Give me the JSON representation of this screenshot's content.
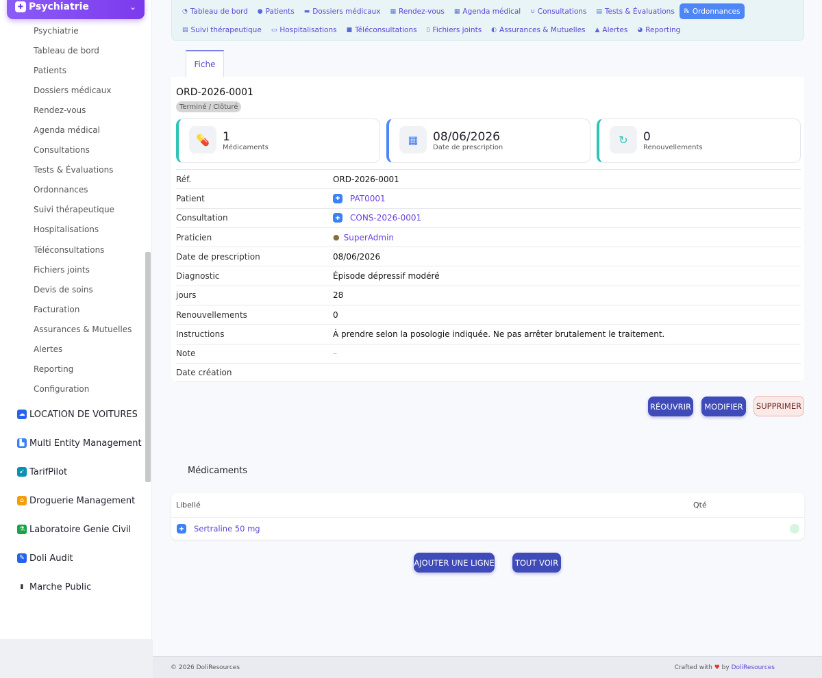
{
  "sidebar": {
    "module_label": "Psychiatrie",
    "items": [
      {
        "label": "Psychiatrie"
      },
      {
        "label": "Tableau de bord"
      },
      {
        "label": "Patients"
      },
      {
        "label": "Dossiers médicaux"
      },
      {
        "label": "Rendez-vous"
      },
      {
        "label": "Agenda médical"
      },
      {
        "label": "Consultations"
      },
      {
        "label": "Tests & Évaluations"
      },
      {
        "label": "Ordonnances"
      },
      {
        "label": "Suivi thérapeutique"
      },
      {
        "label": "Hospitalisations"
      },
      {
        "label": "Téléconsultations"
      },
      {
        "label": "Fichiers joints"
      },
      {
        "label": "Devis de soins"
      },
      {
        "label": "Facturation"
      },
      {
        "label": "Assurances & Mutuelles"
      },
      {
        "label": "Alertes"
      },
      {
        "label": "Reporting"
      },
      {
        "label": "Configuration"
      }
    ],
    "apps": [
      {
        "label": "LOCATION DE VOITURES",
        "icon": "car-icon",
        "color": "#2563eb"
      },
      {
        "label": "Multi Entity Management",
        "icon": "building-icon",
        "color": "#3b82f6"
      },
      {
        "label": "TarifPilot",
        "icon": "tag-icon",
        "color": "#0891b2"
      },
      {
        "label": "Droguerie Management",
        "icon": "store-icon",
        "color": "#f59e0b"
      },
      {
        "label": "Laboratoire Genie Civil",
        "icon": "flask-icon",
        "color": "#16a34a"
      },
      {
        "label": "Doli Audit",
        "icon": "audit-icon",
        "color": "#2563eb"
      },
      {
        "label": "Marche Public",
        "icon": "document-icon",
        "color": "#333333"
      }
    ]
  },
  "topnav": {
    "row1": [
      {
        "label": "Tableau de bord",
        "icon": "gauge-icon",
        "glyph": "◔"
      },
      {
        "label": "Patients",
        "icon": "user-icon",
        "glyph": "●"
      },
      {
        "label": "Dossiers médicaux",
        "icon": "folder-icon",
        "glyph": "▬"
      },
      {
        "label": "Rendez-vous",
        "icon": "calendar-check-icon",
        "glyph": "▦"
      },
      {
        "label": "Agenda médical",
        "icon": "calendar-icon",
        "glyph": "▦"
      },
      {
        "label": "Consultations",
        "icon": "stethoscope-icon",
        "glyph": "∪"
      },
      {
        "label": "Tests & Évaluations",
        "icon": "clipboard-icon",
        "glyph": "▤"
      },
      {
        "label": "Ordonnances",
        "icon": "prescription-icon",
        "glyph": "℞",
        "active": true
      }
    ],
    "row2": [
      {
        "label": "Suivi thérapeutique",
        "icon": "notes-icon",
        "glyph": "▤"
      },
      {
        "label": "Hospitalisations",
        "icon": "bed-icon",
        "glyph": "▭"
      },
      {
        "label": "Téléconsultations",
        "icon": "video-icon",
        "glyph": "■"
      },
      {
        "label": "Fichiers joints",
        "icon": "file-icon",
        "glyph": "▯"
      },
      {
        "label": "Assurances & Mutuelles",
        "icon": "shield-icon",
        "glyph": "◐"
      },
      {
        "label": "Alertes",
        "icon": "warning-icon",
        "glyph": "▲"
      },
      {
        "label": "Reporting",
        "icon": "pie-chart-icon",
        "glyph": "◕"
      }
    ]
  },
  "tab": {
    "label": "Fiche"
  },
  "record": {
    "ref": "ORD-2026-0001",
    "status": "Terminé / Clôturé",
    "stats": [
      {
        "value": "1",
        "label": "Médicaments",
        "icon": "pills-icon",
        "glyph": "💊",
        "color": "#2ec4b6"
      },
      {
        "value": "08/06/2026",
        "label": "Date de prescription",
        "icon": "calendar-icon",
        "glyph": "▦",
        "color": "#4f86f7"
      },
      {
        "value": "0",
        "label": "Renouvellements",
        "icon": "refresh-icon",
        "glyph": "↻",
        "color": "#2ec4b6"
      }
    ],
    "fields": [
      {
        "label": "Réf.",
        "value": "ORD-2026-0001",
        "type": "text"
      },
      {
        "label": "Patient",
        "value": "PAT0001",
        "type": "link-chip"
      },
      {
        "label": "Consultation",
        "value": "CONS-2026-0001",
        "type": "link-chip"
      },
      {
        "label": "Praticien",
        "value": "SuperAdmin",
        "type": "link-user"
      },
      {
        "label": "Date de prescription",
        "value": "08/06/2026",
        "type": "text"
      },
      {
        "label": "Diagnostic",
        "value": "Épisode dépressif modéré",
        "type": "text"
      },
      {
        "label": "jours",
        "value": "28",
        "type": "text"
      },
      {
        "label": "Renouvellements",
        "value": "0",
        "type": "text"
      },
      {
        "label": "Instructions",
        "value": "À prendre selon la posologie indiquée. Ne pas arrêter brutalement le traitement.",
        "type": "text"
      },
      {
        "label": "Note",
        "value": "–",
        "type": "muted"
      },
      {
        "label": "Date création",
        "value": "",
        "type": "text"
      }
    ]
  },
  "actions": {
    "reopen": "RÉOUVRIR",
    "edit": "MODIFIER",
    "delete": "SUPPRIMER"
  },
  "medications": {
    "title": "Médicaments",
    "col_label": "Libellé",
    "col_qty": "Qté",
    "rows": [
      {
        "label": "Sertraline 50 mg",
        "qty": ""
      }
    ],
    "add_line": "AJOUTER UNE LIGNE",
    "see_all": "TOUT VOIR"
  },
  "footer": {
    "copyright": "© 2026 DoliResources",
    "crafted": "Crafted with",
    "by": "by",
    "brand": "DoliResources"
  }
}
